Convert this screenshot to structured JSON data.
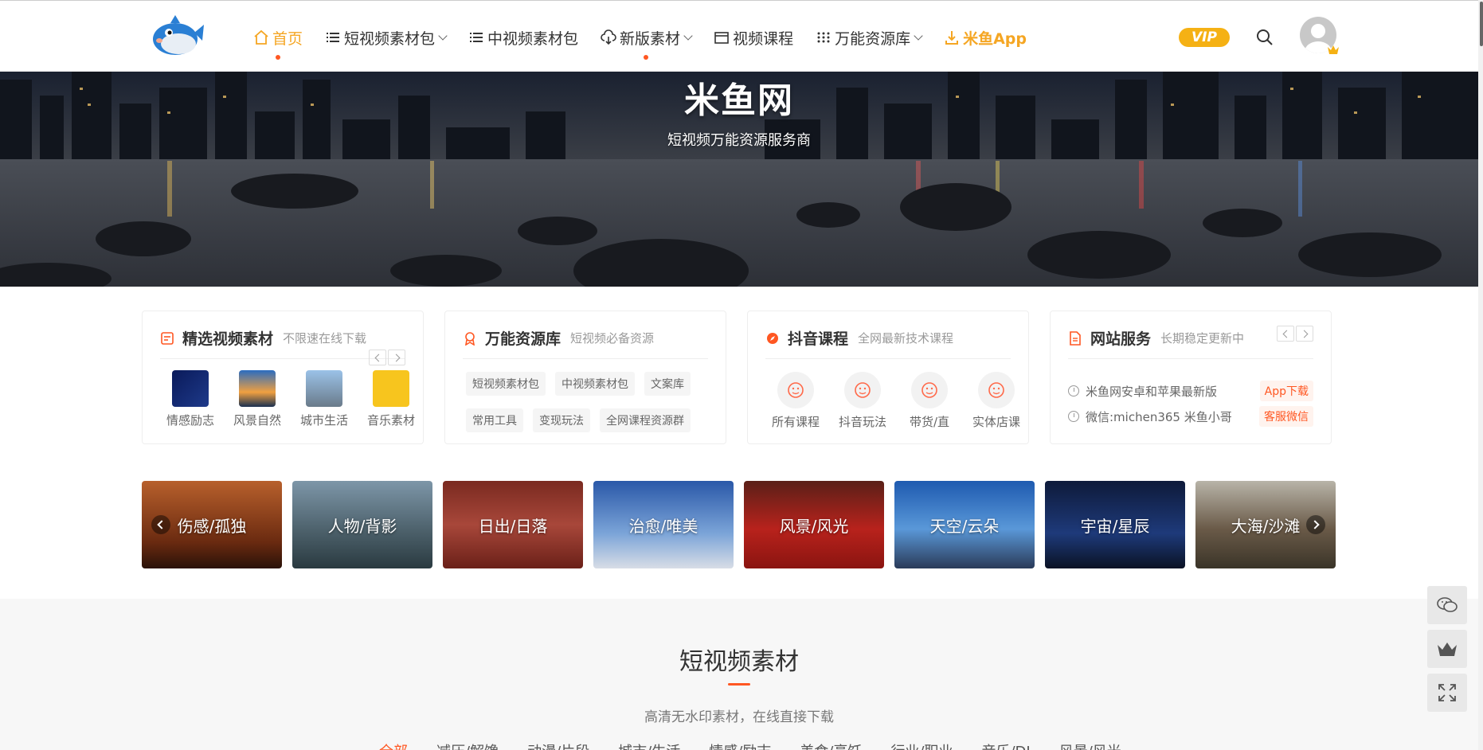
{
  "nav": {
    "items": [
      {
        "label": "首页",
        "icon": "home-icon",
        "active": true
      },
      {
        "label": "短视频素材包",
        "icon": "list-icon",
        "dropdown": true
      },
      {
        "label": "中视频素材包",
        "icon": "list-icon"
      },
      {
        "label": "新版素材",
        "icon": "cloud-download-icon",
        "dropdown": true
      },
      {
        "label": "视频课程",
        "icon": "window-icon"
      },
      {
        "label": "万能资源库",
        "icon": "grid-icon",
        "dropdown": true
      },
      {
        "label": "米鱼App",
        "icon": "download-icon"
      }
    ],
    "vip_label": "VIP",
    "accent": "#f5a623"
  },
  "hero": {
    "title": "米鱼网",
    "subtitle": "短视频万能资源服务商"
  },
  "cards": {
    "materials": {
      "title": "精选视频素材",
      "subtitle": "不限速在线下载",
      "items": [
        "情感励志",
        "风景自然",
        "城市生活",
        "音乐素材"
      ]
    },
    "resources": {
      "title": "万能资源库",
      "subtitle": "短视频必备资源",
      "tags": [
        "短视频素材包",
        "中视频素材包",
        "文案库",
        "常用工具",
        "变现玩法",
        "全网课程资源群"
      ]
    },
    "courses": {
      "title": "抖音课程",
      "subtitle": "全网最新技术课程",
      "items": [
        "所有课程",
        "抖音玩法",
        "带货/直",
        "实体店课"
      ]
    },
    "services": {
      "title": "网站服务",
      "subtitle": "长期稳定更新中",
      "rows": [
        {
          "text": "米鱼网安卓和苹果最新版",
          "button": "App下载"
        },
        {
          "text": "微信:michen365 米鱼小哥",
          "button": "客服微信"
        }
      ]
    }
  },
  "categories": [
    "伤感/孤独",
    "人物/背影",
    "日出/日落",
    "治愈/唯美",
    "风景/风光",
    "天空/云朵",
    "宇宙/星辰",
    "大海/沙滩"
  ],
  "section": {
    "title": "短视频素材",
    "subtitle": "高清无水印素材，在线直接下载",
    "tabs": [
      "全部",
      "减压/解馋",
      "动漫/片段",
      "城市/生活",
      "情感/励志",
      "美食/烹饪",
      "行业/职业",
      "音乐/DJ",
      "风景/风光"
    ]
  }
}
